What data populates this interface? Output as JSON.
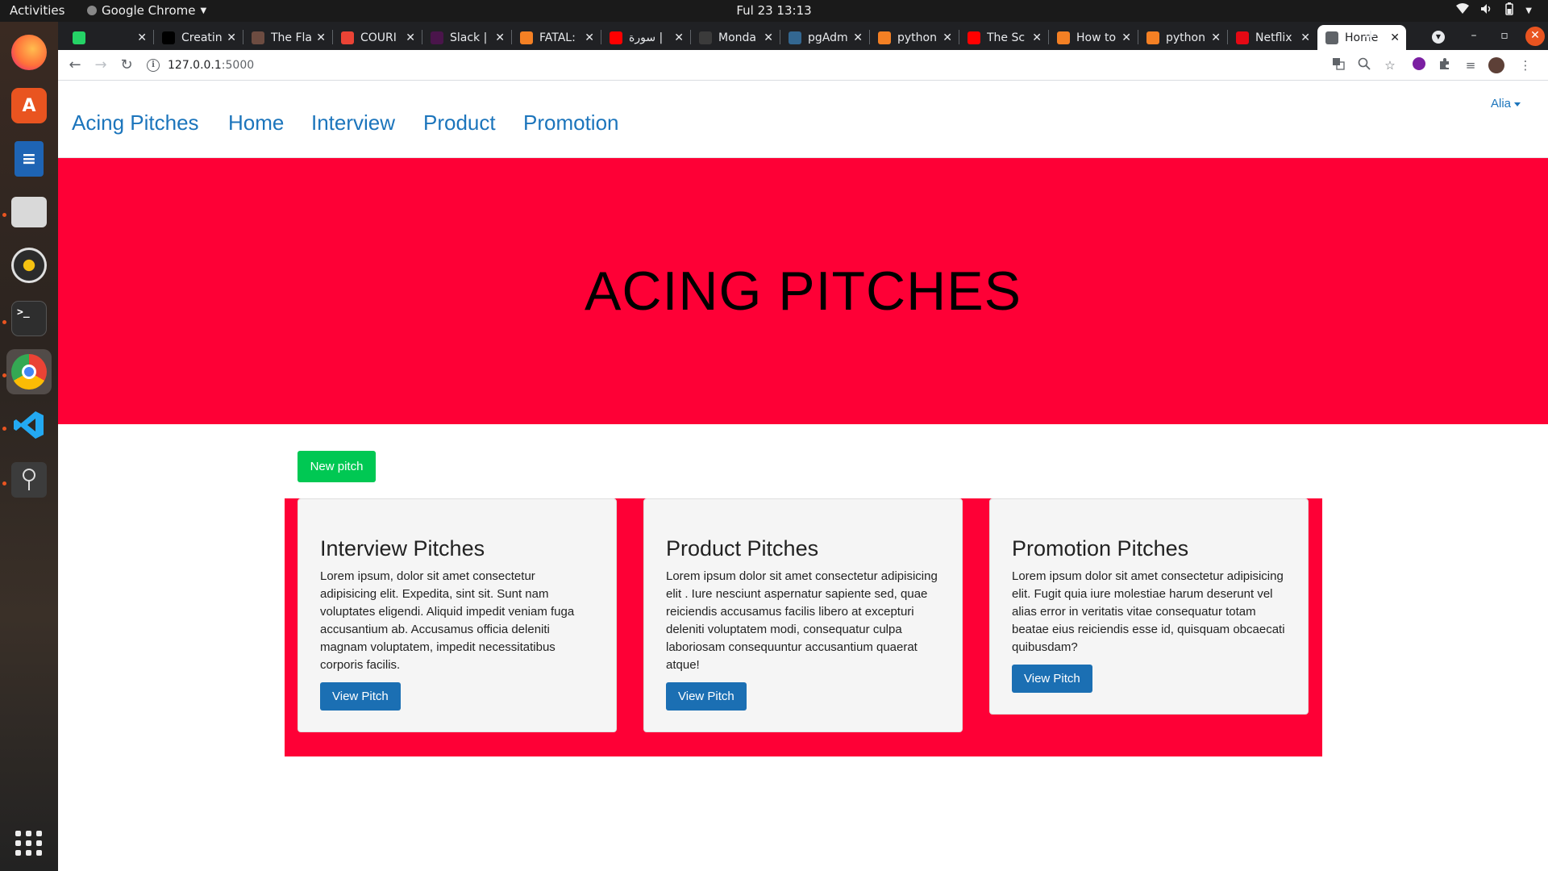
{
  "system": {
    "activities": "Activities",
    "app_name": "Google Chrome",
    "clock": "Ful 23  13:13"
  },
  "browser": {
    "tabs": [
      {
        "title": "",
        "icon": "whatsapp-icon",
        "color": "#25d366"
      },
      {
        "title": "Creatin",
        "icon": "medium-icon",
        "color": "#000000"
      },
      {
        "title": "The Fla",
        "icon": "avatar-icon",
        "color": "#6d4c41"
      },
      {
        "title": "COURI",
        "icon": "gmail-icon",
        "color": "#ea4335"
      },
      {
        "title": "Slack | ",
        "icon": "slack-icon",
        "color": "#4a154b"
      },
      {
        "title": "FATAL:",
        "icon": "stackoverflow-icon",
        "color": "#f48024"
      },
      {
        "title": "سورة |",
        "icon": "youtube-icon",
        "color": "#ff0000"
      },
      {
        "title": "Monda",
        "icon": "leaf-icon",
        "color": "#3b3b3b"
      },
      {
        "title": "pgAdm",
        "icon": "pgadmin-icon",
        "color": "#336791"
      },
      {
        "title": "python",
        "icon": "stackoverflow-icon",
        "color": "#f48024"
      },
      {
        "title": "The Sc",
        "icon": "youtube-icon",
        "color": "#ff0000"
      },
      {
        "title": "How to",
        "icon": "stackoverflow-icon",
        "color": "#f48024"
      },
      {
        "title": "python",
        "icon": "stackoverflow-icon",
        "color": "#f48024"
      },
      {
        "title": "Netflix",
        "icon": "netflix-icon",
        "color": "#e50914"
      },
      {
        "title": "Home",
        "icon": "globe-icon",
        "color": "#5f6368",
        "active": true
      }
    ],
    "url_host": "127.0.0.1",
    "url_port": ":5000"
  },
  "site": {
    "brand": "Acing Pitches",
    "nav": [
      "Home",
      "Interview",
      "Product",
      "Promotion"
    ],
    "user": "Alia",
    "hero_title": "ACING PITCHES",
    "new_pitch_label": "New pitch",
    "cards": [
      {
        "title": "Interview Pitches",
        "body": "Lorem ipsum, dolor sit amet consectetur adipisicing elit. Expedita, sint sit. Sunt nam voluptates eligendi. Aliquid impedit veniam fuga accusantium ab. Accusamus officia deleniti magnam voluptatem, impedit necessitatibus corporis facilis.",
        "button": "View Pitch"
      },
      {
        "title": "Product Pitches",
        "body": "Lorem ipsum dolor sit amet consectetur adipisicing elit . Iure nesciunt aspernatur sapiente sed, quae reiciendis accusamus facilis libero at excepturi deleniti voluptatem modi, consequatur culpa laboriosam consequuntur accusantium quaerat atque!",
        "button": "View Pitch"
      },
      {
        "title": "Promotion Pitches",
        "body": "Lorem ipsum dolor sit amet consectetur adipisicing elit. Fugit quia iure molestiae harum deserunt vel alias error in veritatis vitae consequatur totam beatae eius reiciendis esse id, quisquam obcaecati quibusdam?",
        "button": "View Pitch"
      }
    ]
  },
  "colors": {
    "brand_red": "#fe0036",
    "link_blue": "#1c75bc",
    "button_blue": "#1b6fb3",
    "new_pitch_green": "#00c853"
  }
}
